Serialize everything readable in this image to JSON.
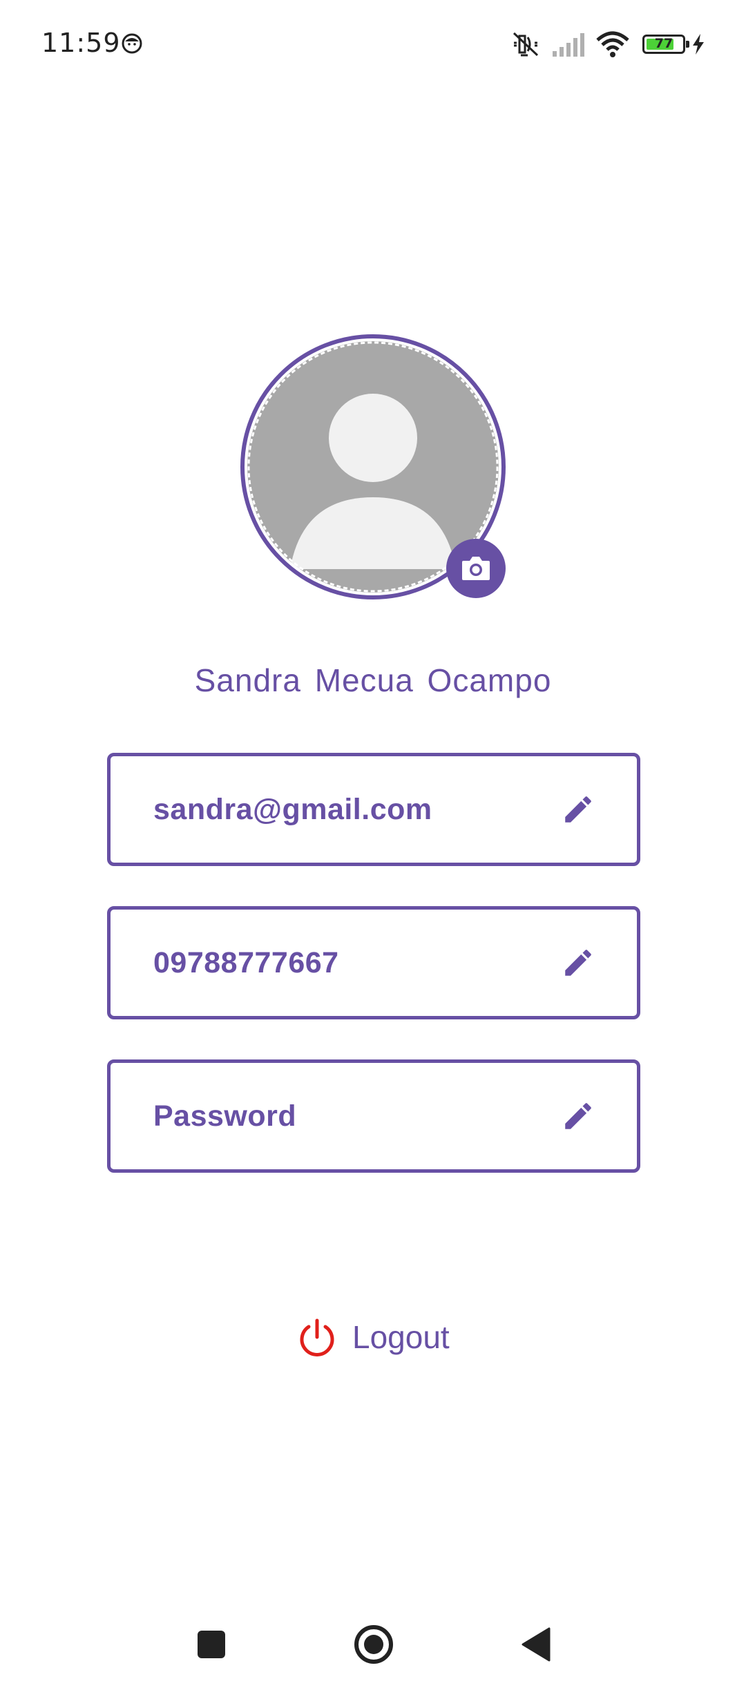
{
  "status_bar": {
    "time": "11:59",
    "battery_level": "77",
    "battery_fraction": 0.77,
    "icons": [
      "face-icon",
      "mute-icon",
      "signal-icon",
      "wifi-icon",
      "battery-icon",
      "charging-bolt-icon"
    ]
  },
  "profile": {
    "avatar_icon": "default-person-avatar",
    "camera_icon": "camera-icon",
    "name": "Sandra Mecua Ocampo"
  },
  "fields": {
    "email": {
      "value": "sandra@gmail.com",
      "edit_icon": "pencil-icon"
    },
    "phone": {
      "value": "09788777667",
      "edit_icon": "pencil-icon"
    },
    "password": {
      "value": "Password",
      "edit_icon": "pencil-icon"
    }
  },
  "logout": {
    "label": "Logout",
    "icon": "power-icon",
    "icon_color": "#e0201b"
  },
  "nav_bar": {
    "icons": [
      "recents-square-icon",
      "home-circle-icon",
      "back-triangle-icon"
    ]
  },
  "colors": {
    "accent": "#6750a4",
    "avatar_bg": "#a8a8a8",
    "avatar_figure": "#f1f1f1",
    "danger": "#e0201b"
  }
}
